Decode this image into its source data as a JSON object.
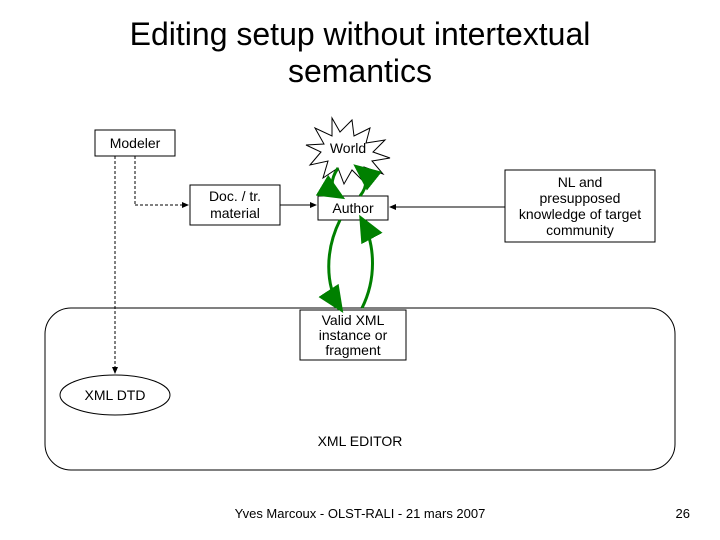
{
  "title_line1": "Editing setup without intertextual",
  "title_line2": "semantics",
  "nodes": {
    "modeler": "Modeler",
    "doc": "Doc. / tr.",
    "doc2": "material",
    "world": "World",
    "author": "Author",
    "nl1": "NL and",
    "nl2": "presupposed",
    "nl3": "knowledge of target",
    "nl4": "community",
    "valid1": "Valid XML",
    "valid2": "instance or",
    "valid3": "fragment",
    "dtd": "XML DTD",
    "editor": "XML EDITOR"
  },
  "footer": "Yves Marcoux - OLST-RALI - 21 mars 2007",
  "page": "26"
}
